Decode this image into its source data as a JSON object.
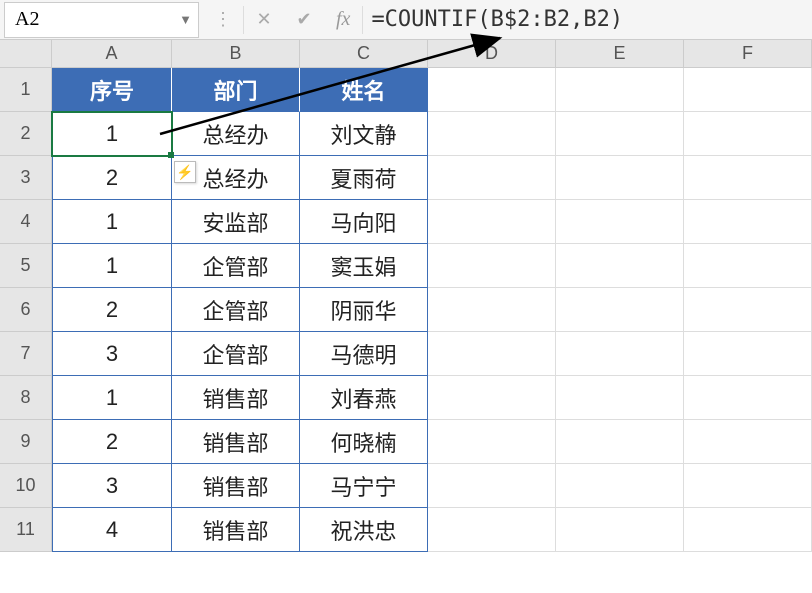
{
  "namebox": "A2",
  "formula": "=COUNTIF(B$2:B2,B2)",
  "fx_label": "fx",
  "col_headers": [
    "A",
    "B",
    "C",
    "D",
    "E",
    "F"
  ],
  "row_headers": [
    "1",
    "2",
    "3",
    "4",
    "5",
    "6",
    "7",
    "8",
    "9",
    "10",
    "11"
  ],
  "table_headers": {
    "a": "序号",
    "b": "部门",
    "c": "姓名"
  },
  "rows": [
    {
      "a": "1",
      "b": "总经办",
      "c": "刘文静"
    },
    {
      "a": "2",
      "b": "总经办",
      "c": "夏雨荷"
    },
    {
      "a": "1",
      "b": "安监部",
      "c": "马向阳"
    },
    {
      "a": "1",
      "b": "企管部",
      "c": "窦玉娟"
    },
    {
      "a": "2",
      "b": "企管部",
      "c": "阴丽华"
    },
    {
      "a": "3",
      "b": "企管部",
      "c": "马德明"
    },
    {
      "a": "1",
      "b": "销售部",
      "c": "刘春燕"
    },
    {
      "a": "2",
      "b": "销售部",
      "c": "何晓楠"
    },
    {
      "a": "3",
      "b": "销售部",
      "c": "马宁宁"
    },
    {
      "a": "4",
      "b": "销售部",
      "c": "祝洪忠"
    }
  ],
  "autofill_icon": "⚡",
  "chart_data": {
    "type": "table",
    "title": "",
    "columns": [
      "序号",
      "部门",
      "姓名"
    ],
    "data": [
      [
        1,
        "总经办",
        "刘文静"
      ],
      [
        2,
        "总经办",
        "夏雨荷"
      ],
      [
        1,
        "安监部",
        "马向阳"
      ],
      [
        1,
        "企管部",
        "窦玉娟"
      ],
      [
        2,
        "企管部",
        "阴丽华"
      ],
      [
        3,
        "企管部",
        "马德明"
      ],
      [
        1,
        "销售部",
        "刘春燕"
      ],
      [
        2,
        "销售部",
        "何晓楠"
      ],
      [
        3,
        "销售部",
        "马宁宁"
      ],
      [
        4,
        "销售部",
        "祝洪忠"
      ]
    ],
    "selected_cell": "A2",
    "formula": "=COUNTIF(B$2:B2,B2)"
  }
}
